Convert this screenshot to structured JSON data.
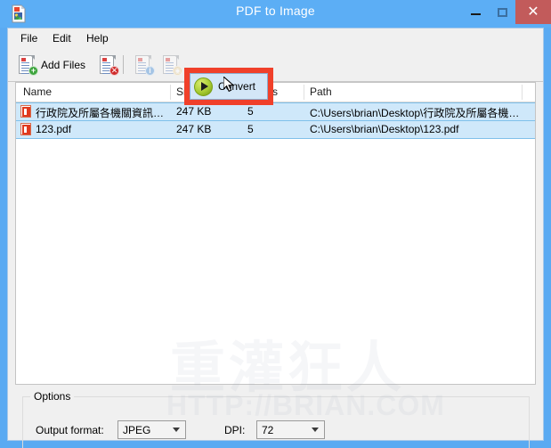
{
  "window": {
    "title": "PDF to Image",
    "app_icon": "image-document-icon",
    "minimize_label": "–",
    "maximize_label": "□",
    "close_label": "✕",
    "accent_color": "#5caef5",
    "close_color": "#c25b5b"
  },
  "menubar": {
    "items": [
      {
        "label": "File"
      },
      {
        "label": "Edit"
      },
      {
        "label": "Help"
      }
    ]
  },
  "toolbar": {
    "add_files_label": "Add Files",
    "remove_files_label": "",
    "info_label": "",
    "preview_label": "",
    "convert_label": "Convert",
    "highlight_color": "#f0402a"
  },
  "filelist": {
    "columns": [
      "Name",
      "Size",
      "Pages",
      "Path"
    ],
    "rows": [
      {
        "name": "行政院及所屬各機關資訊…",
        "size": "247 KB",
        "pages": "5",
        "path": "C:\\Users\\brian\\Desktop\\行政院及所屬各機…",
        "selected": true
      },
      {
        "name": "123.pdf",
        "size": "247 KB",
        "pages": "5",
        "path": "C:\\Users\\brian\\Desktop\\123.pdf",
        "selected": true
      }
    ]
  },
  "options": {
    "legend": "Options",
    "output_format_label": "Output format:",
    "output_format_value": "JPEG",
    "dpi_label": "DPI:",
    "dpi_value": "72"
  },
  "watermark": {
    "cjk": "重灌狂人",
    "url": "HTTP://BRIAN.COM"
  }
}
